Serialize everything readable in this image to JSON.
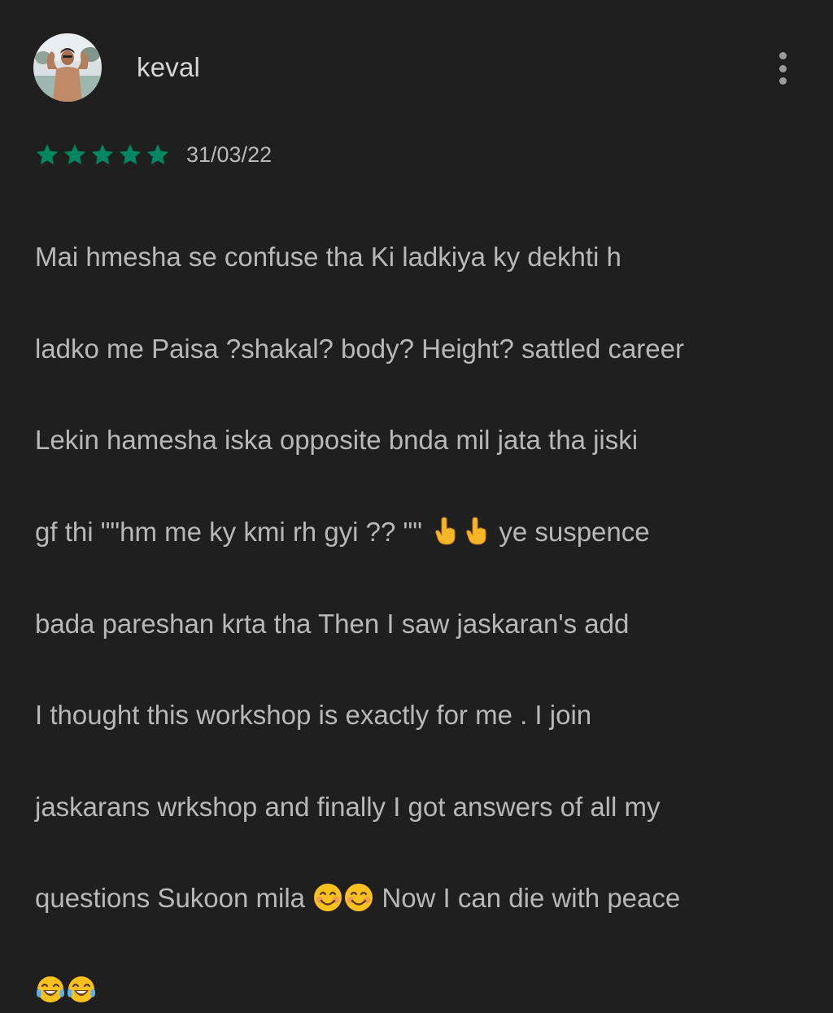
{
  "review_card": {
    "author_name": "keval",
    "avatar_icon": "user-photo-avatar",
    "menu_icon": "more-vert-icon",
    "rating": 5,
    "rating_max": 5,
    "star_color": "#01875f",
    "date": "31/03/22",
    "text_lines": [
      "Mai hmesha se confuse tha Ki ladkiya ky dekhti h",
      "ladko me Paisa ?shakal? body? Height? sattled career",
      "Lekin hamesha iska opposite bnda mil jata tha jiski",
      "gf thi \"\"hm me ky kmi rh gyi ?? \"\" ",
      " ye suspence",
      "bada pareshan krta tha Then I saw jaskaran's add",
      "I thought this workshop is exactly for me . I join",
      "jaskarans wrkshop and finally I got answers of all my",
      "questions Sukoon mila ",
      " Now I can die with peace"
    ],
    "emojis": {
      "pointing_down": "pointing-down-hand-emoji",
      "smiling": "smiling-face-emoji",
      "laughing": "tears-of-joy-emoji"
    }
  }
}
